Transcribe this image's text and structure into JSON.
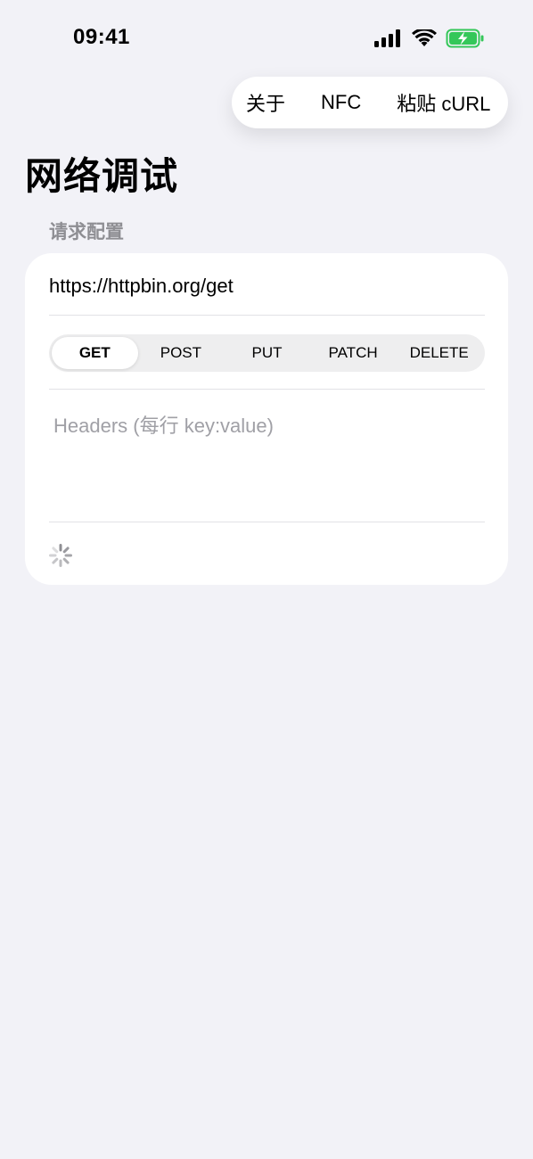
{
  "status_bar": {
    "time": "09:41",
    "icons": [
      "cellular-signal-icon",
      "wifi-icon",
      "battery-charging-icon"
    ],
    "battery_color": "#34c759"
  },
  "menu": {
    "items": [
      {
        "label": "关于"
      },
      {
        "label": "NFC"
      },
      {
        "label": "粘贴 cURL"
      }
    ]
  },
  "page": {
    "title": "网络调试",
    "section_label": "请求配置"
  },
  "request": {
    "url": "https://httpbin.org/get",
    "methods": [
      "GET",
      "POST",
      "PUT",
      "PATCH",
      "DELETE"
    ],
    "selected_method": "GET",
    "headers_placeholder": "Headers (每行 key:value)",
    "headers_value": ""
  },
  "colors": {
    "background": "#f2f2f7",
    "card": "#ffffff",
    "secondary_text": "#8e8e93"
  }
}
